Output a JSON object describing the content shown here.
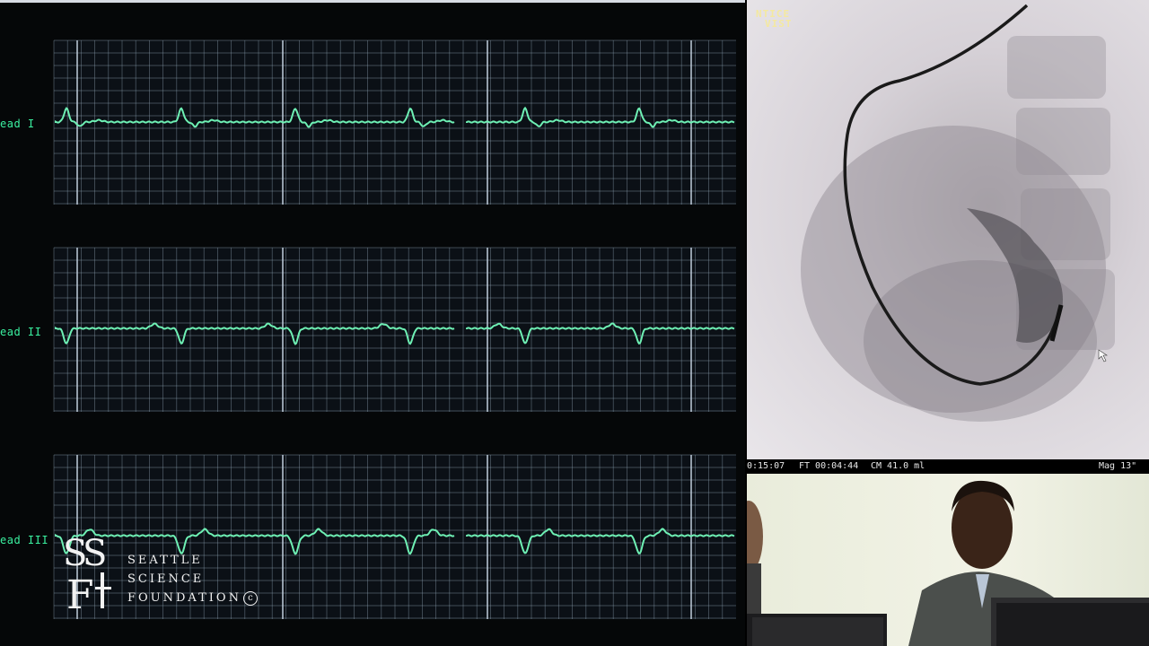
{
  "ecg": {
    "leads": [
      {
        "label": "ead I"
      },
      {
        "label": "ead II"
      },
      {
        "label": "ead III"
      }
    ],
    "trace_color": "#6ef0b4",
    "grid_color": "#8fa4b4"
  },
  "fluoro": {
    "brand_line1": "NTICE",
    "brand_line2": "VIST",
    "status": {
      "time": "0:15:07",
      "ft": "FT 00:04:44",
      "cm": "CM 41.0 ml",
      "mag": "Mag 13\""
    }
  },
  "logo": {
    "line1": "SEATTLE",
    "line2": "SCIENCE",
    "line3": "FOUNDATION",
    "copyright": "c"
  }
}
